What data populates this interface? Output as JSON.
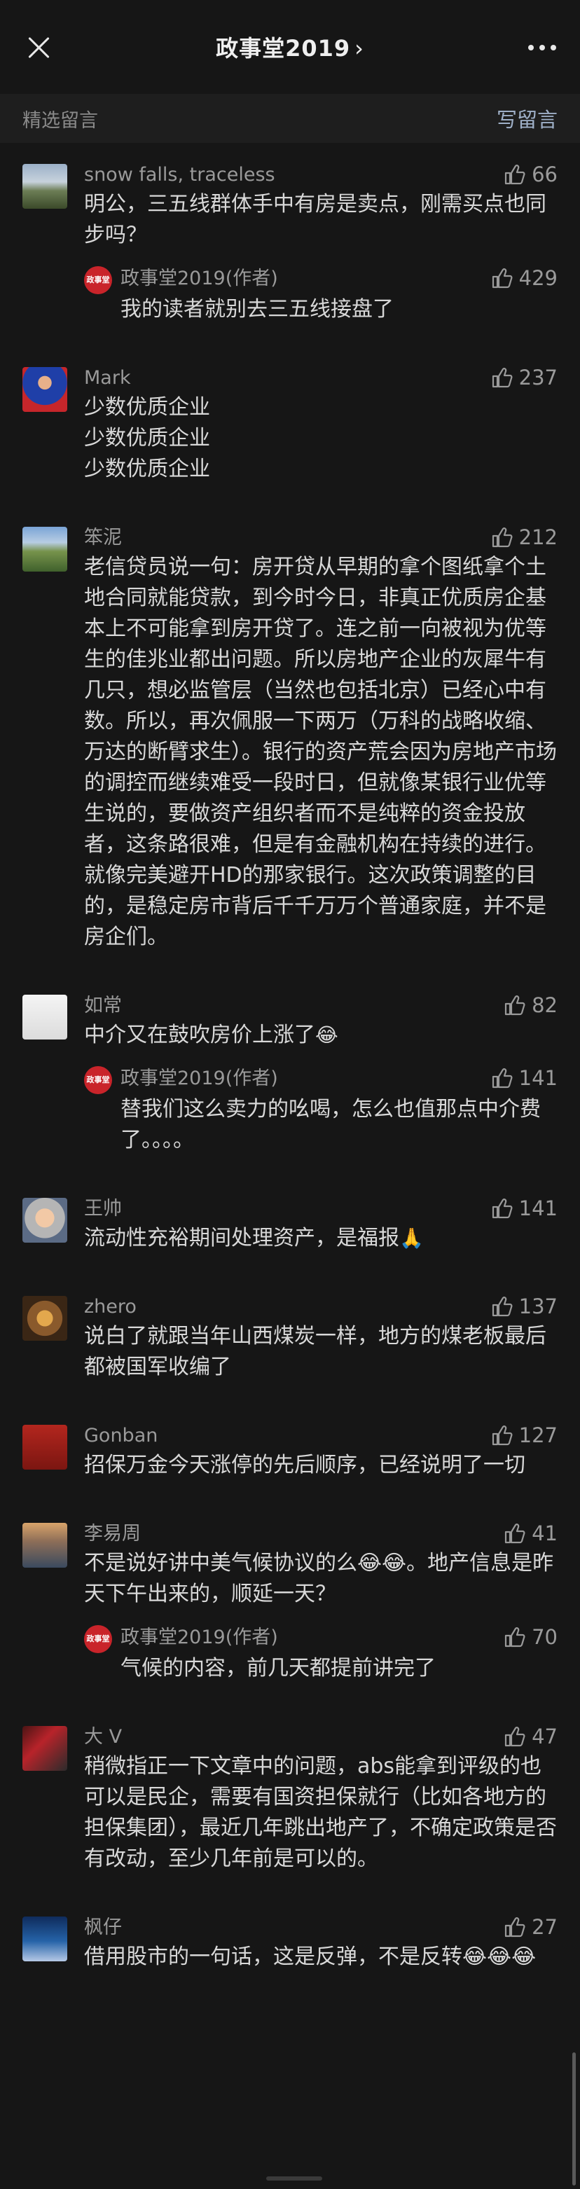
{
  "header": {
    "title": "政事堂2019",
    "chevron": "›"
  },
  "section": {
    "left": "精选留言",
    "right": "写留言"
  },
  "colors": {
    "background": "#161616",
    "text": "#d8d8d8",
    "meta": "#9a9a9a",
    "link": "#9fb0c8",
    "author_badge": "#c9242a"
  },
  "comments": [
    {
      "name": "snow falls, traceless",
      "likes": "66",
      "text": "明公，三五线群体手中有房是卖点，刚需买点也同步吗？",
      "reply": {
        "name": "政事堂2019(作者)",
        "likes": "429",
        "text": "我的读者就别去三五线接盘了"
      }
    },
    {
      "name": "Mark",
      "likes": "237",
      "text": "少数优质企业\n少数优质企业\n少数优质企业"
    },
    {
      "name": "笨泥",
      "likes": "212",
      "text": "老信贷员说一句：房开贷从早期的拿个图纸拿个土地合同就能贷款，到今时今日，非真正优质房企基本上不可能拿到房开贷了。连之前一向被视为优等生的佳兆业都出问题。所以房地产企业的灰犀牛有几只，想必监管层（当然也包括北京）已经心中有数。所以，再次佩服一下两万（万科的战略收缩、万达的断臂求生）。银行的资产荒会因为房地产市场的调控而继续难受一段时日，但就像某银行业优等生说的，要做资产组织者而不是纯粹的资金投放者，这条路很难，但是有金融机构在持续的进行。就像完美避开HD的那家银行。这次政策调整的目的，是稳定房市背后千千万万个普通家庭，并不是房企们。"
    },
    {
      "name": "如常",
      "likes": "82",
      "text": "中介又在鼓吹房价上涨了",
      "emoji": "😂",
      "reply": {
        "name": "政事堂2019(作者)",
        "likes": "141",
        "text": "替我们这么卖力的吆喝，怎么也值那点中介费了。。。。"
      }
    },
    {
      "name": "王帅",
      "likes": "141",
      "text": "流动性充裕期间处理资产，是福报",
      "emoji": "🙏"
    },
    {
      "name": "zhero",
      "likes": "137",
      "text": "说白了就跟当年山西煤炭一样，地方的煤老板最后都被国军收编了"
    },
    {
      "name": "Gonban",
      "likes": "127",
      "text": "招保万金今天涨停的先后顺序，已经说明了一切"
    },
    {
      "name": "李易周",
      "likes": "41",
      "text": "不是说好讲中美气候协议的么😂😂。地产信息是昨天下午出来的，顺延一天？",
      "reply": {
        "name": "政事堂2019(作者)",
        "likes": "70",
        "text": "气候的内容，前几天都提前讲完了"
      }
    },
    {
      "name": "大 V",
      "likes": "47",
      "text": "稍微指正一下文章中的问题，abs能拿到评级的也可以是民企，需要有国资担保就行（比如各地方的担保集团），最近几年跳出地产了，不确定政策是否有改动，至少几年前是可以的。"
    },
    {
      "name": "枫仔",
      "likes": "27",
      "text": "借用股市的一句话，这是反弹，不是反转😂😂😂"
    }
  ],
  "author_badge_text": "政事堂"
}
